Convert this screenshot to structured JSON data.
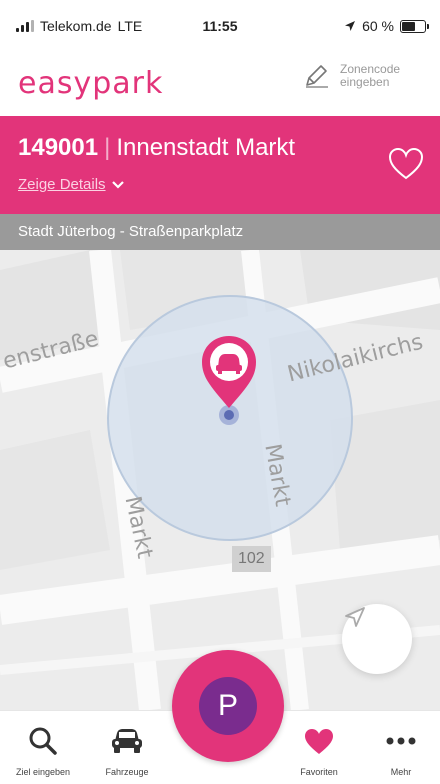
{
  "status_bar": {
    "carrier": "Telekom.de",
    "network": "LTE",
    "time": "11:55",
    "battery_text": "60 %",
    "battery_level": 0.6
  },
  "header": {
    "logo": "easypark",
    "zone_code_label": "Zonencode eingeben"
  },
  "zone": {
    "code": "149001",
    "name": "Innenstadt Markt",
    "details_link": "Zeige Details",
    "subtitle": "Stadt Jüterbog - Straßenparkplatz"
  },
  "map": {
    "street_labels": [
      "enstraße",
      "Nikolaikirchs",
      "Markt",
      "Markt"
    ],
    "road_number": "102"
  },
  "tabs": [
    {
      "label": "Ziel eingeben",
      "icon": "search-icon"
    },
    {
      "label": "Fahrzeuge",
      "icon": "car-icon"
    },
    {
      "label": "P",
      "icon": "parking-icon"
    },
    {
      "label": "Favoriten",
      "icon": "heart-icon"
    },
    {
      "label": "Mehr",
      "icon": "more-icon"
    }
  ],
  "colors": {
    "brand_pink": "#e2347a",
    "brand_purple": "#7a2c8e",
    "subtitle_gray": "#9a9a9a"
  }
}
